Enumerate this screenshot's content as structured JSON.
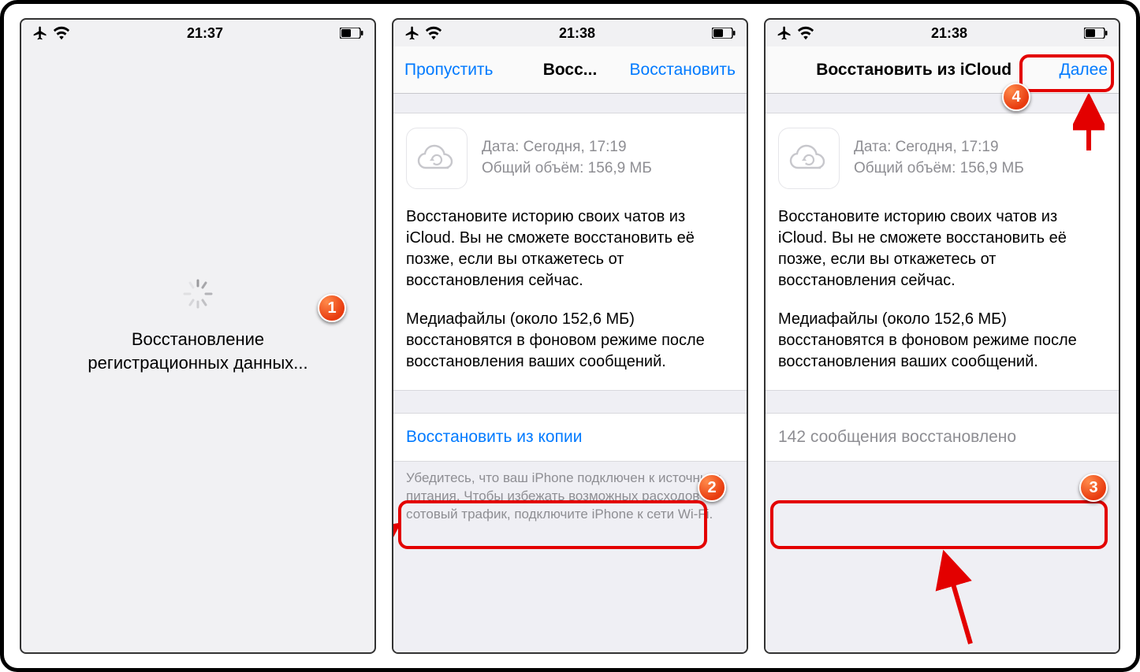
{
  "screen1": {
    "status": {
      "time": "21:37"
    },
    "loading_text": "Восстановление\nрегистрационных данных...",
    "callout": "1"
  },
  "screen2": {
    "status": {
      "time": "21:38"
    },
    "nav": {
      "left": "Пропустить",
      "title": "Восс...",
      "right": "Восстановить"
    },
    "backup": {
      "date": "Дата: Сегодня, 17:19",
      "size": "Общий объём: 156,9 МБ"
    },
    "desc1": "Восстановите историю своих чатов из iCloud. Вы не сможете восстановить её позже, если вы откажетесь от восстановления сейчас.",
    "desc2": "Медиафайлы (около 152,6 МБ) восстановятся в фоновом режиме после восстановления ваших сообщений.",
    "action": "Восстановить из копии",
    "footer": "Убедитесь, что ваш iPhone подключен к источнику питания. Чтобы избежать возможных расходов за сотовый трафик, подключите iPhone к сети Wi-Fi.",
    "callout": "2"
  },
  "screen3": {
    "status": {
      "time": "21:38"
    },
    "nav": {
      "title": "Восстановить из iCloud",
      "right": "Далее"
    },
    "backup": {
      "date": "Дата: Сегодня, 17:19",
      "size": "Общий объём: 156,9 МБ"
    },
    "desc1": "Восстановите историю своих чатов из iCloud. Вы не сможете восстановить её позже, если вы откажетесь от восстановления сейчас.",
    "desc2": "Медиафайлы (около 152,6 МБ) восстановятся в фоновом режиме после восстановления ваших сообщений.",
    "status_text": "142 сообщения восстановлено",
    "callout3": "3",
    "callout4": "4"
  }
}
